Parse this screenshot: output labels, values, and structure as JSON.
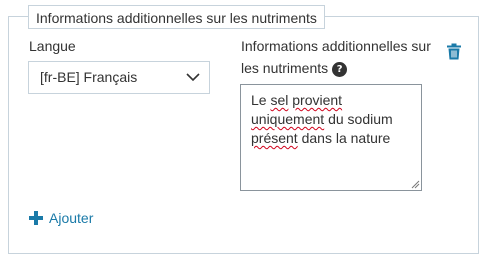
{
  "fieldset": {
    "legend": "Informations additionnelles sur les nutriments"
  },
  "language": {
    "label": "Langue",
    "selected": "[fr-BE] Français"
  },
  "additional_info": {
    "label": "Informations additionnelles sur les nutriments",
    "help_glyph": "?",
    "value_words": [
      "Le",
      "sel",
      "provient",
      "uniquement",
      "du",
      "sodium",
      "présent",
      "dans",
      "la",
      "nature"
    ]
  },
  "actions": {
    "add_label": "Ajouter"
  },
  "icons": {
    "delete": "trash-icon",
    "add": "plus-icon",
    "dropdown": "chevron-down-icon",
    "help": "help-icon"
  },
  "colors": {
    "border": "#c7d3dc",
    "accent": "#1a7aa8",
    "text": "#333333",
    "spellcheck": "#d0021b"
  }
}
